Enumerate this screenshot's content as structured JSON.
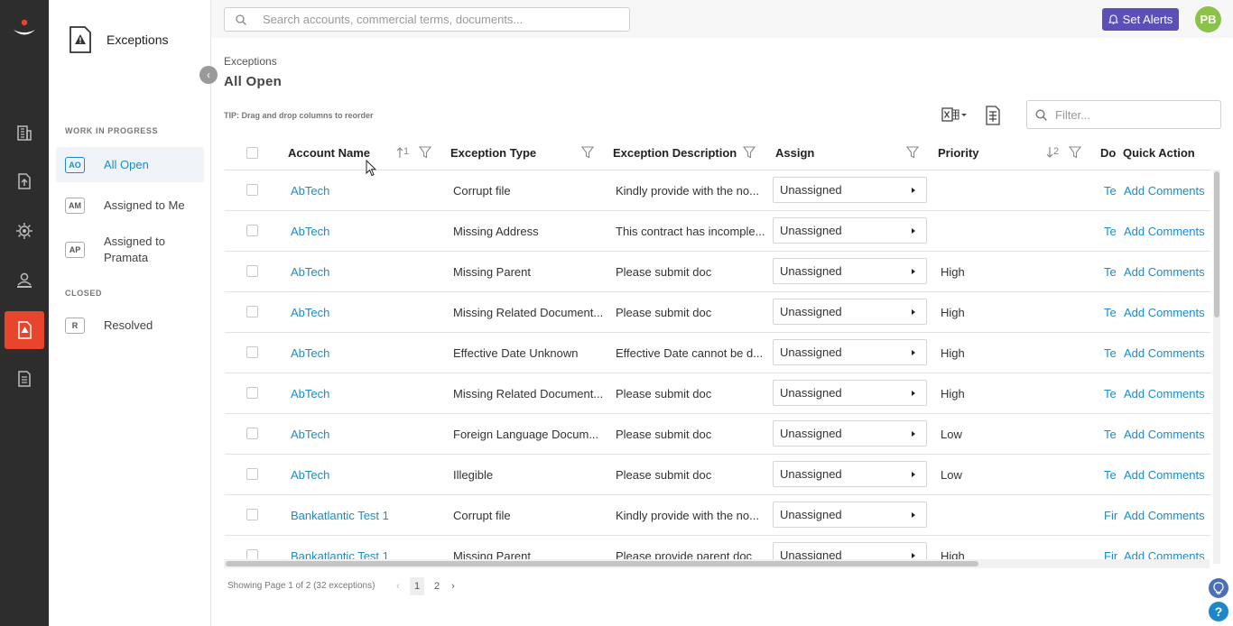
{
  "topbar": {
    "search_placeholder": "Search accounts, commercial terms, documents...",
    "alerts_label": "Set Alerts",
    "avatar_initials": "PB"
  },
  "sidebar": {
    "title": "Exceptions",
    "sections": [
      {
        "label": "WORK IN PROGRESS",
        "items": [
          {
            "abbr": "AO",
            "label": "All Open"
          },
          {
            "abbr": "AM",
            "label": "Assigned to Me"
          },
          {
            "abbr": "AP",
            "label": "Assigned to Pramata"
          }
        ]
      },
      {
        "label": "CLOSED",
        "items": [
          {
            "abbr": "R",
            "label": "Resolved"
          }
        ]
      }
    ]
  },
  "main": {
    "breadcrumb": "Exceptions",
    "title": "All Open",
    "tip": "TIP: Drag and drop columns to reorder",
    "filter_placeholder": "Filter..."
  },
  "grid": {
    "columns": {
      "account": "Account Name",
      "account_sort": "1",
      "type": "Exception Type",
      "desc": "Exception Description",
      "assign": "Assign",
      "priority": "Priority",
      "priority_sort": "2",
      "doc": "Do",
      "action": "Quick Action"
    },
    "rows": [
      {
        "account": "AbTech",
        "type": "Corrupt file",
        "desc": "Kindly provide with the no...",
        "assign": "Unassigned",
        "priority": "",
        "doc": "Te",
        "action": "Add Comments"
      },
      {
        "account": "AbTech",
        "type": "Missing Address",
        "desc": "This contract has incomple...",
        "assign": "Unassigned",
        "priority": "",
        "doc": "Te",
        "action": "Add Comments"
      },
      {
        "account": "AbTech",
        "type": "Missing Parent",
        "desc": "Please submit doc",
        "assign": "Unassigned",
        "priority": "High",
        "doc": "Te",
        "action": "Add Comments"
      },
      {
        "account": "AbTech",
        "type": "Missing Related Document...",
        "desc": "Please submit doc",
        "assign": "Unassigned",
        "priority": "High",
        "doc": "Te",
        "action": "Add Comments"
      },
      {
        "account": "AbTech",
        "type": "Effective Date Unknown",
        "desc": "Effective Date cannot be d...",
        "assign": "Unassigned",
        "priority": "High",
        "doc": "Te",
        "action": "Add Comments"
      },
      {
        "account": "AbTech",
        "type": "Missing Related Document...",
        "desc": "Please submit doc",
        "assign": "Unassigned",
        "priority": "High",
        "doc": "Te",
        "action": "Add Comments"
      },
      {
        "account": "AbTech",
        "type": "Foreign Language Docum...",
        "desc": "Please submit doc",
        "assign": "Unassigned",
        "priority": "Low",
        "doc": "Te",
        "action": "Add Comments"
      },
      {
        "account": "AbTech",
        "type": "Illegible",
        "desc": "Please submit doc",
        "assign": "Unassigned",
        "priority": "Low",
        "doc": "Te",
        "action": "Add Comments"
      },
      {
        "account": "Bankatlantic Test 1",
        "type": "Corrupt file",
        "desc": "Kindly provide with the no...",
        "assign": "Unassigned",
        "priority": "",
        "doc": "Fir",
        "action": "Add Comments"
      },
      {
        "account": "Bankatlantic Test 1",
        "type": "Missing Parent",
        "desc": "Please provide parent doc",
        "assign": "Unassigned",
        "priority": "High",
        "doc": "Fir",
        "action": "Add Comments"
      }
    ]
  },
  "pagination": {
    "summary": "Showing Page 1 of 2 (32 exceptions)",
    "prev": "‹",
    "pages": [
      "1",
      "2"
    ],
    "next": "›"
  },
  "colors": {
    "rail_bg": "#2d2d2d",
    "rail_active": "#e8462c",
    "link": "#1a8ccc",
    "alerts_btn": "#5b4fb8",
    "avatar": "#8bc34a"
  },
  "icons": {
    "rail": [
      "logo-icon",
      "building-icon",
      "upload-document-icon",
      "gear-cluster-icon",
      "person-desk-icon",
      "exception-alert-icon",
      "report-icon"
    ]
  }
}
